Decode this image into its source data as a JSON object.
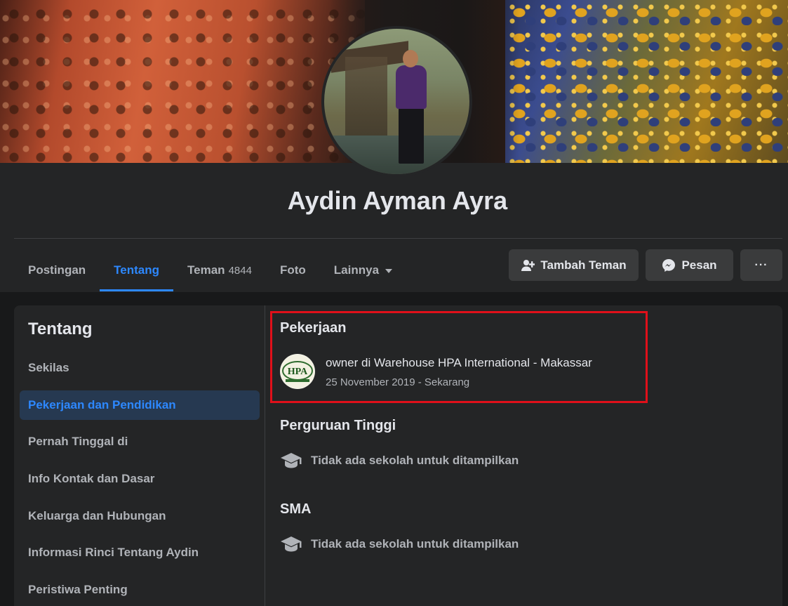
{
  "profile": {
    "name": "Aydin Ayman Ayra"
  },
  "tabs": [
    {
      "label": "Postingan"
    },
    {
      "label": "Tentang"
    },
    {
      "label": "Teman",
      "count": "4844"
    },
    {
      "label": "Foto"
    },
    {
      "label": "Lainnya"
    }
  ],
  "actions": {
    "add_friend": "Tambah Teman",
    "message": "Pesan",
    "more": "···"
  },
  "sidebar": {
    "title": "Tentang",
    "items": [
      {
        "label": "Sekilas"
      },
      {
        "label": "Pekerjaan dan Pendidikan"
      },
      {
        "label": "Pernah Tinggal di"
      },
      {
        "label": "Info Kontak dan Dasar"
      },
      {
        "label": "Keluarga dan Hubungan"
      },
      {
        "label": "Informasi Rinci Tentang Aydin"
      },
      {
        "label": "Peristiwa Penting"
      }
    ]
  },
  "work": {
    "title": "Pekerjaan",
    "job": "owner di Warehouse HPA International - Makassar",
    "dates": "25 November 2019 - Sekarang",
    "logo_text": "HPA"
  },
  "college": {
    "title": "Perguruan Tinggi",
    "empty": "Tidak ada sekolah untuk ditampilkan"
  },
  "highschool": {
    "title": "SMA",
    "empty": "Tidak ada sekolah untuk ditampilkan"
  },
  "colors": {
    "accent": "#2d88ff",
    "highlight_border": "#e0101a",
    "background": "#18191a",
    "card": "#242526"
  },
  "icons": {
    "add_friend": "person-plus-icon",
    "message": "messenger-icon",
    "more": "ellipsis-icon",
    "dropdown": "caret-down-icon",
    "school": "graduation-cap-icon"
  }
}
